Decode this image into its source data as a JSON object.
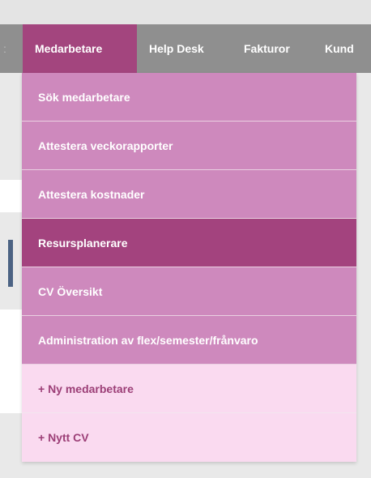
{
  "nav": {
    "edge_glyph": ":",
    "items": [
      {
        "label": "Medarbetare",
        "active": true
      },
      {
        "label": "Help Desk",
        "active": false
      },
      {
        "label": "Fakturor",
        "active": false
      },
      {
        "label": "Kund",
        "active": false
      }
    ]
  },
  "dropdown": {
    "items": [
      {
        "label": "Sök medarbetare",
        "style": "pink"
      },
      {
        "label": "Attestera veckorapporter",
        "style": "pink"
      },
      {
        "label": "Attestera kostnader",
        "style": "pink"
      },
      {
        "label": "Resursplanerare",
        "style": "selected"
      },
      {
        "label": "CV Översikt",
        "style": "pink"
      },
      {
        "label": "Administration av flex/semester/frånvaro",
        "style": "pink"
      },
      {
        "label": "+ Ny medarbetare",
        "style": "light"
      },
      {
        "label": "+ Nytt CV",
        "style": "light"
      }
    ]
  },
  "colors": {
    "navbar": "#8f8f8f",
    "active_tab": "#a3457e",
    "menu_item": "#ce89bd",
    "menu_item_selected": "#a3437e",
    "menu_item_light": "#fadaf0",
    "menu_item_light_text": "#9c3f77"
  }
}
